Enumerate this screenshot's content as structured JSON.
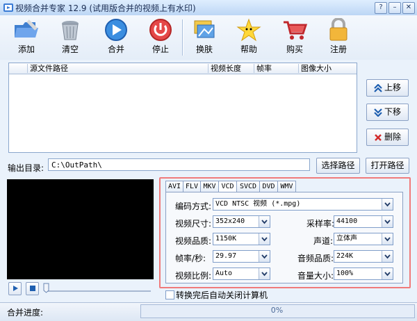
{
  "window": {
    "title": "视频合并专家 12.9 (试用版合并的视频上有水印)"
  },
  "toolbar": {
    "add": "添加",
    "clear": "清空",
    "merge": "合并",
    "stop": "停止",
    "skin": "换肤",
    "help": "帮助",
    "buy": "购买",
    "register": "注册"
  },
  "file_list": {
    "columns": [
      "源文件路径",
      "视频长度",
      "帧率",
      "图像大小"
    ]
  },
  "side_buttons": {
    "up": "上移",
    "down": "下移",
    "delete": "删除"
  },
  "output": {
    "label": "输出目录:",
    "path": "C:\\OutPath\\",
    "choose_button": "选择路径",
    "open_button": "打开路径"
  },
  "tabs": [
    "AVI",
    "FLV",
    "MKV",
    "VCD",
    "SVCD",
    "DVD",
    "WMV"
  ],
  "active_tab": "VCD",
  "settings": {
    "encoder_label": "编码方式:",
    "encoder_value": "VCD NTSC 视频 (*.mpg)",
    "size_label": "视频尺寸:",
    "size_value": "352x240",
    "vquality_label": "视频品质:",
    "vquality_value": "1150K",
    "fps_label": "帧率/秒:",
    "fps_value": "29.97",
    "ratio_label": "视频比例:",
    "ratio_value": "Auto",
    "samplerate_label": "采样率:",
    "samplerate_value": "44100",
    "channel_label": "声道:",
    "channel_value": "立体声",
    "aquality_label": "音频品质:",
    "aquality_value": "224K",
    "volume_label": "音量大小:",
    "volume_value": "100%"
  },
  "autoclose": {
    "label": "转换完后自动关闭计算机",
    "checked": false
  },
  "progress": {
    "label": "合并进度:",
    "text": "0%",
    "value": 0
  },
  "colors": {
    "highlight_border": "#f07a7a",
    "accent": "#1f5fb0"
  }
}
